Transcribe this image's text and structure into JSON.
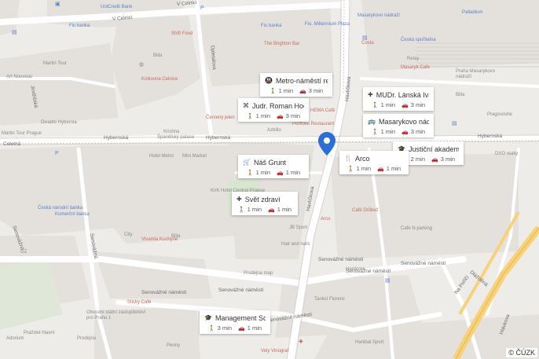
{
  "map": {
    "copyright": "© ČÚZK",
    "streets": [
      {
        "text": "V Celnici",
        "name": "street-v-celnici"
      },
      {
        "text": "V Celnici",
        "name": "street-v-celnici-2"
      },
      {
        "text": "Hybernská",
        "name": "street-hybernska-1"
      },
      {
        "text": "Hybernská",
        "name": "street-hybernska-2"
      },
      {
        "text": "Hybernská",
        "name": "street-hybernska-3"
      },
      {
        "text": "Havlíčkova",
        "name": "street-havlickova"
      },
      {
        "text": "Havlíčkova",
        "name": "street-havlickova-2"
      },
      {
        "text": "Senovážné náměstí",
        "name": "street-senovazne-1"
      },
      {
        "text": "Senovážné náměstí",
        "name": "street-senovazne-2"
      },
      {
        "text": "Senovážné náměstí",
        "name": "street-senovazne-3"
      },
      {
        "text": "Senovážné náměstí",
        "name": "street-senovazne-4"
      },
      {
        "text": "Senovážné náměstí",
        "name": "street-senovazne-5"
      },
      {
        "text": "Senovážné náměstí",
        "name": "street-senovazne-6"
      },
      {
        "text": "Senovážná",
        "name": "street-senovazna"
      },
      {
        "text": "Senovážná",
        "name": "street-senovazna-2"
      },
      {
        "text": "Na Poříčí",
        "name": "street-na-poric"
      },
      {
        "text": "Celetná",
        "name": "street-celetna"
      },
      {
        "text": "Dlážděná",
        "name": "street-dlazdena"
      },
      {
        "text": "Hlávkova",
        "name": "street-hlavkova"
      },
      {
        "text": "Opletalova",
        "name": "street-opletalova"
      },
      {
        "text": "Jindřišská",
        "name": "street-jindrisska"
      }
    ],
    "places": [
      {
        "text": "UniCredit Bank",
        "name": "place-unicredit"
      },
      {
        "text": "Fio banka",
        "name": "place-fio-banka"
      },
      {
        "text": "Shift Food",
        "name": "place-shift-food"
      },
      {
        "text": "Fio banka",
        "name": "place-fio-banka-2"
      },
      {
        "text": "Fio. Millennium Plaza",
        "name": "place-millennium"
      },
      {
        "text": "Masarykovo nádraží",
        "name": "place-masarykovo-nadrazi"
      },
      {
        "text": "Palladium",
        "name": "place-palladium"
      },
      {
        "text": "The Brighton Bar",
        "name": "place-brighton-bar"
      },
      {
        "text": "Billa",
        "name": "place-billa"
      },
      {
        "text": "Kolkovna Celnice",
        "name": "place-kolkovna"
      },
      {
        "text": "Martin Tour",
        "name": "place-martin-tour"
      },
      {
        "text": "Art Nouveau",
        "name": "place-art-nouveau"
      },
      {
        "text": "Divadlo Hybernia",
        "name": "place-divadlo-hybernia"
      },
      {
        "text": "Martin Tour Prague",
        "name": "place-martin-tour-prague"
      },
      {
        "text": "Červený jelen",
        "name": "place-cerveny-jelen"
      },
      {
        "text": "HEMA Café",
        "name": "place-hema-cafe"
      },
      {
        "text": "Portfolio Restaurant",
        "name": "place-portfolio"
      },
      {
        "text": "Krishna",
        "name": "place-krishna"
      },
      {
        "text": "Španělský palace",
        "name": "place-spanelsky"
      },
      {
        "text": "Mini Market",
        "name": "place-mini-market"
      },
      {
        "text": "Hotel Metro",
        "name": "place-hotel-metro"
      },
      {
        "text": "Azbillo",
        "name": "place-azbillo"
      },
      {
        "text": "Česká národní banka",
        "name": "place-cnb"
      },
      {
        "text": "Komerční banka",
        "name": "place-komercni"
      },
      {
        "text": "KnK Hotel Central Prague",
        "name": "place-knk-hotel"
      },
      {
        "text": "Billa",
        "name": "place-billa-2"
      },
      {
        "text": "City",
        "name": "place-city"
      },
      {
        "text": "Vivamia Kuchyne",
        "name": "place-vivamia"
      },
      {
        "text": "Hair and nails",
        "name": "place-hair-nails"
      },
      {
        "text": "JB Sport",
        "name": "place-jb-sport"
      },
      {
        "text": "Prodejna map",
        "name": "place-prodejna-map"
      },
      {
        "text": "Arco",
        "name": "place-arco-label"
      },
      {
        "text": "Café Drůbež",
        "name": "place-cafe-drubez"
      },
      {
        "text": "Cafe N parking",
        "name": "place-cafe-parking"
      },
      {
        "text": "Hardcore",
        "name": "place-hardcore"
      },
      {
        "text": "Tankcí Florenc",
        "name": "place-tankci"
      },
      {
        "text": "Sticky Café",
        "name": "place-sticky-cafe"
      },
      {
        "text": "Obvodní státní zastupitelství pro Prahu 1",
        "name": "place-zastupitelstvi"
      },
      {
        "text": "Adorium",
        "name": "place-adorium"
      },
      {
        "text": "Pražské hlavní",
        "name": "place-prazske"
      },
      {
        "text": "Prodejna",
        "name": "place-prodejna"
      },
      {
        "text": "Penny",
        "name": "place-penny"
      },
      {
        "text": "Vely Vinograf",
        "name": "place-vinograf"
      },
      {
        "text": "Hanibal Sport",
        "name": "place-hanibal"
      },
      {
        "text": "GZ",
        "name": "place-gz"
      },
      {
        "text": "Praha Masarykovo nádraží",
        "name": "place-praha-masarykovo"
      },
      {
        "text": "Česká spořitelna",
        "name": "place-ceska-sporitelna"
      },
      {
        "text": "Relay",
        "name": "place-relay"
      },
      {
        "text": "Costa",
        "name": "place-costa"
      },
      {
        "text": "Pragovoshe",
        "name": "place-pragovoshe"
      },
      {
        "text": "DXO realty",
        "name": "place-dxo"
      },
      {
        "text": "Billa",
        "name": "place-billa-3"
      },
      {
        "text": "Masaryk Cafe",
        "name": "place-masaryk-cafe"
      }
    ],
    "cards": [
      {
        "name": "card-metro-namesti-republiky",
        "title": "Metro-náměstí re...",
        "icon": "metro",
        "walk": "1 min",
        "drive": "3 min"
      },
      {
        "name": "card-judr-roman-hoch",
        "title": "Judr. Roman Hoch...",
        "icon": "org",
        "walk": "1 min",
        "drive": "3 min"
      },
      {
        "name": "card-mudr-lanska-iva",
        "title": "MUDr. Lánská Iva",
        "icon": "medical",
        "walk": "1 min",
        "drive": "3 min"
      },
      {
        "name": "card-masarykovo-nadrazi",
        "title": "Masarykovo nádr...",
        "icon": "bus",
        "walk": "1 min",
        "drive": "3 min"
      },
      {
        "name": "card-justicni-akademie",
        "title": "Justiční akademie",
        "icon": "school",
        "walk": "2 min",
        "drive": "3 min"
      },
      {
        "name": "card-arco",
        "title": "Arco",
        "icon": "restaurant",
        "walk": "1 min",
        "drive": "1 min"
      },
      {
        "name": "card-nas-grunt",
        "title": "Náš Grunt",
        "icon": "shop",
        "walk": "1 min",
        "drive": "1 min"
      },
      {
        "name": "card-svet-zdravi",
        "title": "Svět zdraví",
        "icon": "medical",
        "walk": "1 min",
        "drive": "1 min"
      },
      {
        "name": "card-management-school",
        "title": "Management Sch...",
        "icon": "school",
        "walk": "3 min",
        "drive": "1 min"
      }
    ]
  }
}
